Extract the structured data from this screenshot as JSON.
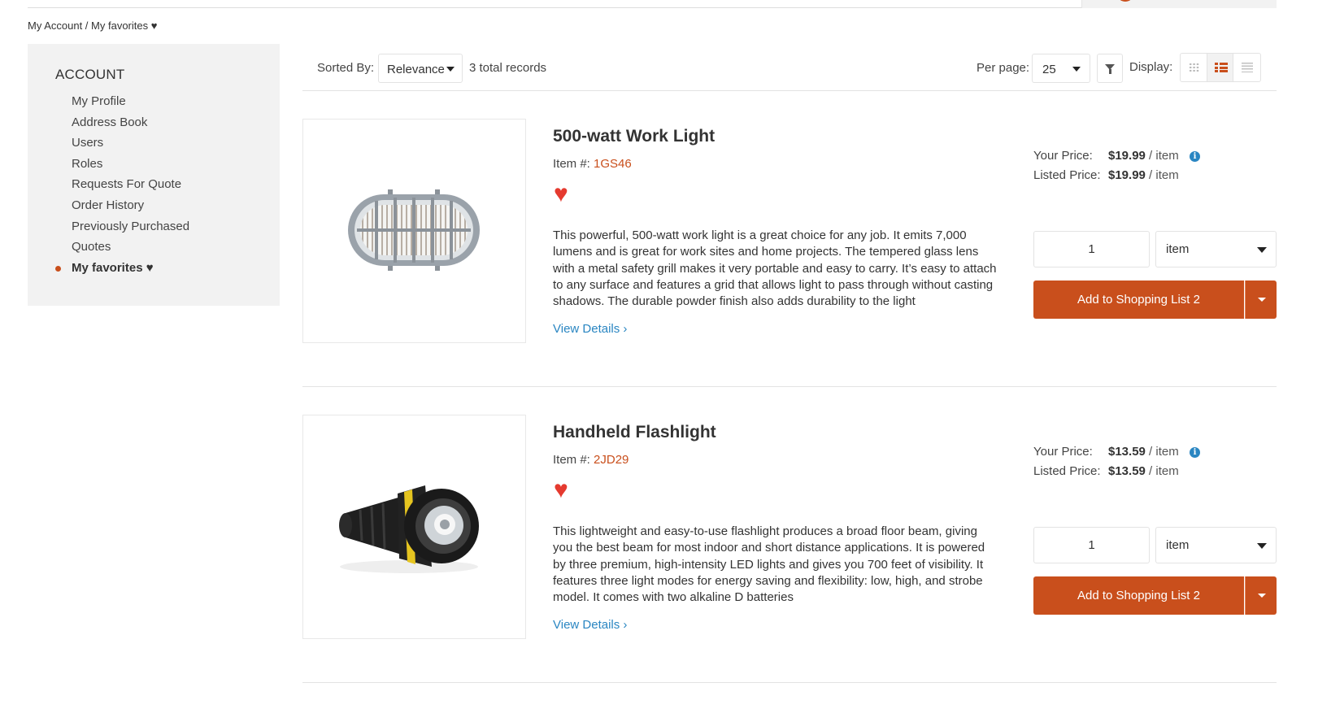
{
  "breadcrumb": "My Account / My favorites ♥",
  "sidebar": {
    "heading": "ACCOUNT",
    "items": [
      {
        "label": "My Profile"
      },
      {
        "label": "Address Book"
      },
      {
        "label": "Users"
      },
      {
        "label": "Roles"
      },
      {
        "label": "Requests For Quote"
      },
      {
        "label": "Order History"
      },
      {
        "label": "Previously Purchased"
      },
      {
        "label": "Quotes"
      },
      {
        "label": "My favorites ♥",
        "active": true
      }
    ]
  },
  "toolbar": {
    "sorted_label": "Sorted By:",
    "sort_value": "Relevance",
    "total": "3 total records",
    "perpage_label": "Per page:",
    "perpage_value": "25",
    "display_label": "Display:",
    "active_view": "list"
  },
  "products": [
    {
      "title": "500-watt Work Light",
      "item_label": "Item #:",
      "item_code": "1GS46",
      "description": "This powerful, 500-watt work light is a great choice for any job. It emits 7,000 lumens and is great for work sites and home projects. The tempered glass lens with a metal safety grill makes it very portable and easy to carry. It’s easy to attach to any surface and features a grid that allows light to pass through without casting shadows. The durable powder finish also adds durability to the light",
      "details_link": "View Details ›",
      "your_price_label": "Your Price:",
      "your_price": "$19.99",
      "listed_price_label": "Listed Price:",
      "listed_price": "$19.99",
      "per_unit": " / item",
      "quantity": "1",
      "unit": "item",
      "add_button": "Add to Shopping List 2",
      "image_icon": "work-light-icon"
    },
    {
      "title": "Handheld Flashlight",
      "item_label": "Item #:",
      "item_code": "2JD29",
      "description": "This lightweight and easy-to-use flashlight produces a broad floor beam, giving you the best beam for most indoor and short distance applications. It is powered by three premium, high-intensity LED lights and gives you 700 feet of visibility. It features three light modes for energy saving and flexibility: low, high, and strobe model. It comes with two alkaline D batteries",
      "details_link": "View Details ›",
      "your_price_label": "Your Price:",
      "your_price": "$13.59",
      "listed_price_label": "Listed Price:",
      "listed_price": "$13.59",
      "per_unit": " / item",
      "quantity": "1",
      "unit": "item",
      "add_button": "Add to Shopping List 2",
      "image_icon": "flashlight-icon"
    }
  ],
  "colors": {
    "accent": "#c94f1c",
    "link": "#2a86c2",
    "heart": "#e53a2f",
    "sidebar_bg": "#f2f2f2"
  }
}
